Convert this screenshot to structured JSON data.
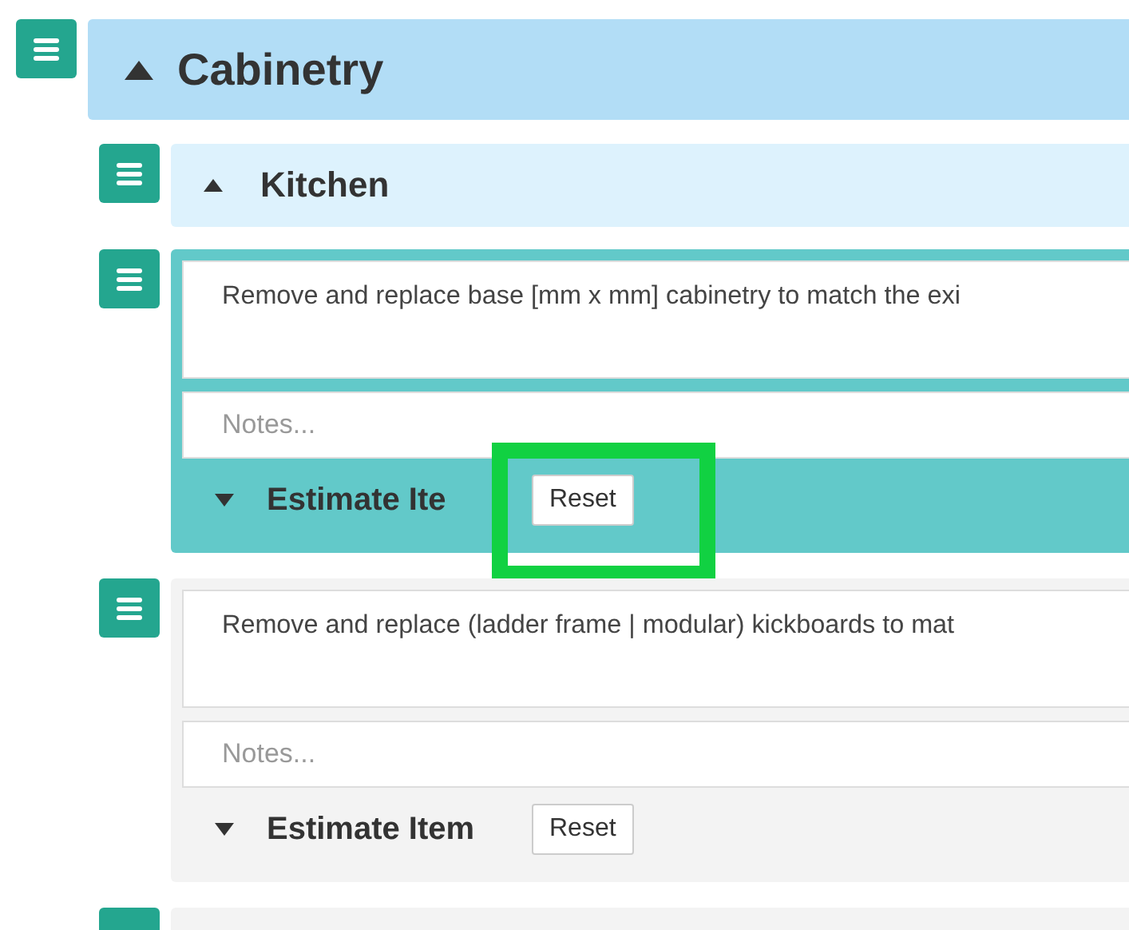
{
  "sections": [
    {
      "title": "Cabinetry",
      "expanded": true,
      "children": [
        {
          "title": "Kitchen",
          "expanded": true,
          "items": [
            {
              "kind": "estimate",
              "description": "Remove and replace base [mm x mm] cabinetry to match the exi",
              "notes_placeholder": "Notes...",
              "footer_title": "Estimate Ite",
              "expanded": false,
              "selected": true,
              "highlighted": true,
              "reset_button": "Reset"
            },
            {
              "kind": "estimate",
              "description": "Remove and replace (ladder frame | modular) kickboards to mat",
              "notes_placeholder": "Notes...",
              "footer_title": "Estimate Item",
              "expanded": false,
              "selected": false,
              "highlighted": false,
              "reset_button": "Reset"
            },
            {
              "kind": "partial"
            }
          ]
        }
      ]
    }
  ]
}
